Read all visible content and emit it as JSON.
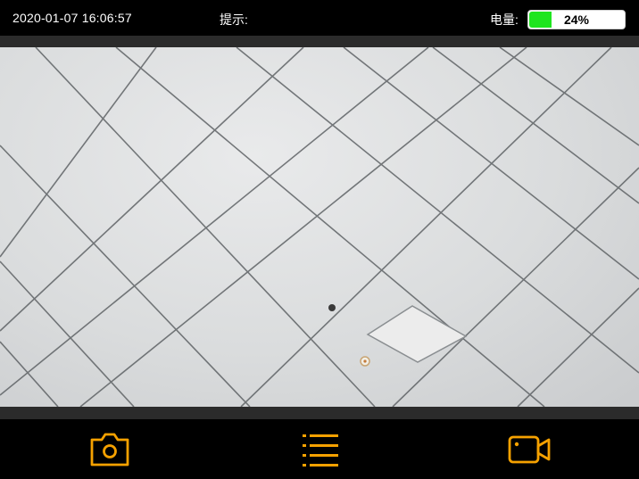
{
  "status": {
    "datetime": "2020-01-07 16:06:57",
    "hint_label": "提示:",
    "battery_label": "电量:",
    "battery_text": "24%",
    "battery_level": 0.24,
    "battery_color": "#1ee51e"
  },
  "toolbar": {
    "icons": [
      "camera-icon",
      "list-icon",
      "video-camera-icon"
    ],
    "accent_color": "#f5a100"
  }
}
